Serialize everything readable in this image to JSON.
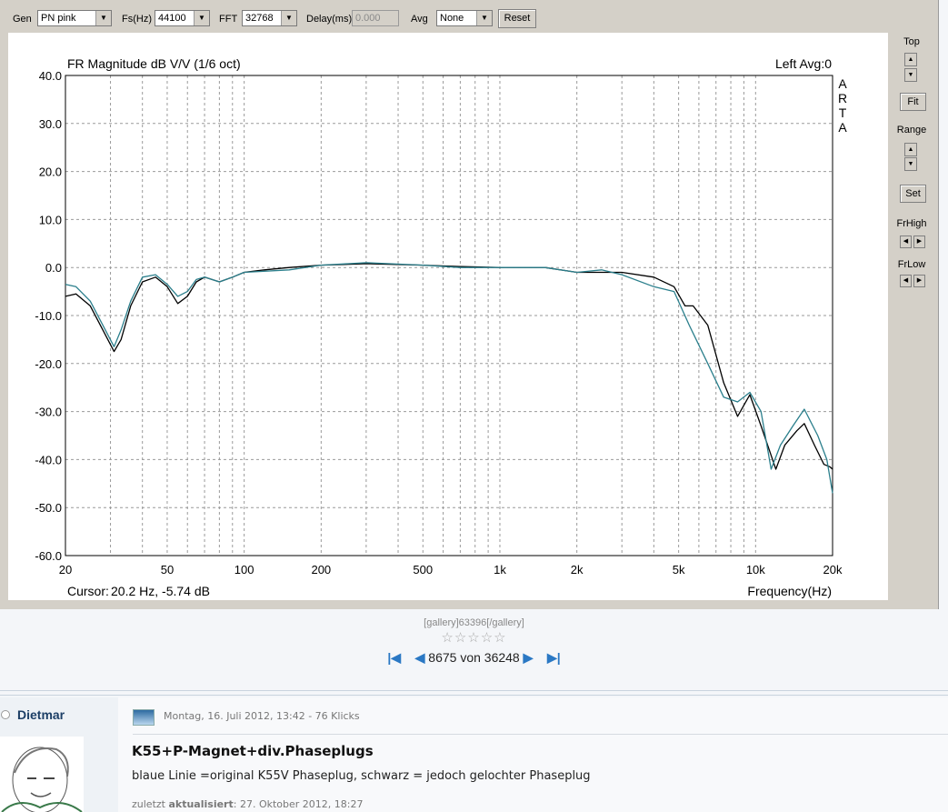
{
  "toolbar": {
    "gen_label": "Gen",
    "gen_value": "PN pink",
    "fs_label": "Fs(Hz)",
    "fs_value": "44100",
    "fft_label": "FFT",
    "fft_value": "32768",
    "delay_label": "Delay(ms)",
    "delay_value": "0.000",
    "avg_label": "Avg",
    "avg_value": "None",
    "reset_label": "Reset"
  },
  "side": {
    "top_label": "Top",
    "fit_label": "Fit",
    "range_label": "Range",
    "set_label": "Set",
    "frhigh_label": "FrHigh",
    "frlow_label": "FrLow"
  },
  "chart_data": {
    "type": "line",
    "title": "FR Magnitude dB V/V (1/6 oct)",
    "channel_label": "Left",
    "avg_label": "Avg:0",
    "brand": "ARTA",
    "xlabel": "Frequency(Hz)",
    "ylabel": "",
    "xscale": "log",
    "xlim": [
      20,
      20000
    ],
    "ylim": [
      -60,
      40
    ],
    "grid": true,
    "yticks": [
      "40.0",
      "30.0",
      "20.0",
      "10.0",
      "0.0",
      "-10.0",
      "-20.0",
      "-30.0",
      "-40.0",
      "-50.0",
      "-60.0"
    ],
    "xticks": [
      {
        "v": 20,
        "t": "20"
      },
      {
        "v": 50,
        "t": "50"
      },
      {
        "v": 100,
        "t": "100"
      },
      {
        "v": 200,
        "t": "200"
      },
      {
        "v": 500,
        "t": "500"
      },
      {
        "v": 1000,
        "t": "1k"
      },
      {
        "v": 2000,
        "t": "2k"
      },
      {
        "v": 5000,
        "t": "5k"
      },
      {
        "v": 10000,
        "t": "10k"
      },
      {
        "v": 20000,
        "t": "20k"
      }
    ],
    "cursor_label": "Cursor:",
    "cursor_value": "20.2 Hz, -5.74 dB",
    "series": [
      {
        "color": "#000000",
        "points": [
          [
            20,
            -6
          ],
          [
            22,
            -5.5
          ],
          [
            25,
            -8
          ],
          [
            28,
            -13
          ],
          [
            31,
            -17.5
          ],
          [
            33,
            -15
          ],
          [
            36,
            -8
          ],
          [
            40,
            -3
          ],
          [
            45,
            -2
          ],
          [
            50,
            -4
          ],
          [
            55,
            -7.5
          ],
          [
            60,
            -6
          ],
          [
            65,
            -3
          ],
          [
            70,
            -2
          ],
          [
            80,
            -3
          ],
          [
            90,
            -2
          ],
          [
            100,
            -1
          ],
          [
            120,
            -0.5
          ],
          [
            150,
            0
          ],
          [
            200,
            0.5
          ],
          [
            300,
            0.8
          ],
          [
            500,
            0.5
          ],
          [
            700,
            0.2
          ],
          [
            1000,
            0
          ],
          [
            1500,
            0
          ],
          [
            2000,
            -1
          ],
          [
            3000,
            -1
          ],
          [
            4000,
            -2
          ],
          [
            4800,
            -4
          ],
          [
            5300,
            -8
          ],
          [
            5700,
            -8
          ],
          [
            6500,
            -12
          ],
          [
            7500,
            -24
          ],
          [
            8500,
            -31
          ],
          [
            9500,
            -26.5
          ],
          [
            10500,
            -33
          ],
          [
            12000,
            -42
          ],
          [
            13000,
            -37
          ],
          [
            14500,
            -34
          ],
          [
            15500,
            -32.5
          ],
          [
            17000,
            -37
          ],
          [
            18500,
            -41
          ],
          [
            19500,
            -41.5
          ],
          [
            20000,
            -42
          ]
        ]
      },
      {
        "color": "#2b7f8c",
        "points": [
          [
            20,
            -3.5
          ],
          [
            22,
            -4
          ],
          [
            25,
            -7
          ],
          [
            28,
            -12
          ],
          [
            31,
            -16.5
          ],
          [
            33,
            -13
          ],
          [
            36,
            -7
          ],
          [
            40,
            -2
          ],
          [
            45,
            -1.5
          ],
          [
            50,
            -3.5
          ],
          [
            55,
            -6
          ],
          [
            60,
            -5
          ],
          [
            65,
            -2.5
          ],
          [
            70,
            -2
          ],
          [
            80,
            -3
          ],
          [
            90,
            -2
          ],
          [
            100,
            -1
          ],
          [
            150,
            -0.5
          ],
          [
            200,
            0.5
          ],
          [
            300,
            1
          ],
          [
            500,
            0.5
          ],
          [
            700,
            0
          ],
          [
            1000,
            0
          ],
          [
            1500,
            0
          ],
          [
            2000,
            -1
          ],
          [
            2500,
            -0.5
          ],
          [
            3000,
            -1.5
          ],
          [
            4000,
            -4
          ],
          [
            4800,
            -5
          ],
          [
            5500,
            -12
          ],
          [
            6500,
            -20
          ],
          [
            7500,
            -27
          ],
          [
            8500,
            -28
          ],
          [
            9500,
            -26
          ],
          [
            10500,
            -30
          ],
          [
            11500,
            -42
          ],
          [
            12500,
            -37
          ],
          [
            14000,
            -33
          ],
          [
            15500,
            -29.5
          ],
          [
            17500,
            -35
          ],
          [
            19000,
            -40
          ],
          [
            20000,
            -47
          ]
        ]
      }
    ]
  },
  "gallery": {
    "bbcode": "[gallery]63396[/gallery]",
    "rating_stars": 0,
    "counter": "8675 von 36248"
  },
  "post": {
    "username": "Dietmar",
    "date_text": "Montag, 16. Juli 2012, 13:42 - 76 Klicks",
    "title": "K55+P-Magnet+div.Phaseplugs",
    "body": "blaue Linie =original K55V Phaseplug, schwarz = jedoch gelochter Phaseplug",
    "updated_prefix": "zuletzt",
    "updated_bold": "aktualisiert",
    "updated_rest": ": 27. Oktober 2012, 18:27"
  }
}
